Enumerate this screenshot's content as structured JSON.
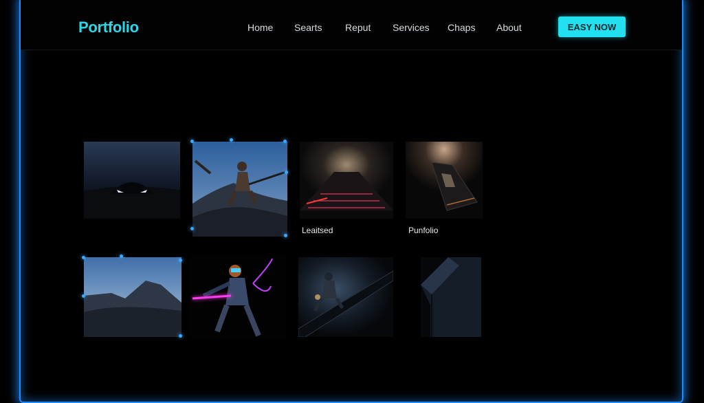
{
  "header": {
    "logo": "Portfolio",
    "nav": [
      "Home",
      "Searts",
      "Reput",
      "Services",
      "Chaps",
      "About"
    ],
    "cta_label": "EASY NOW"
  },
  "gallery": {
    "captions": [
      "Leaitsed",
      "Punfolio"
    ],
    "tiles": [
      "car-at-dusk-image",
      "rider-on-dunes-image",
      "neon-road-image",
      "gadget-device-image",
      "rocky-landscape-image",
      "neon-sword-fighter-image",
      "skater-on-ramp-image",
      "dark-block-image"
    ]
  },
  "colors": {
    "accent": "#22e0f0",
    "logo": "#2bd8e8",
    "frame_glow": "#1d8cff",
    "background": "#000000"
  }
}
